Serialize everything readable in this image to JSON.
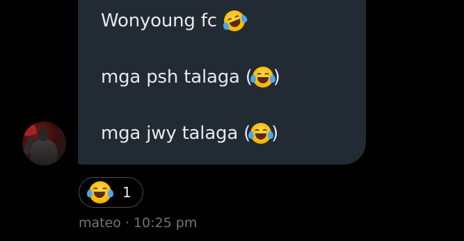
{
  "message": {
    "lines": [
      {
        "text": "Wonyoung fc",
        "emoji": "rolling-on-floor-laughing-emoji"
      },
      {
        "text": "mga psh talaga (",
        "emoji": "tears-of-joy-emoji",
        "after": ")"
      },
      {
        "text": "mga jwy talaga (",
        "emoji": "tears-of-joy-emoji",
        "after": ")"
      }
    ]
  },
  "reaction": {
    "emoji": "tears-of-joy-emoji",
    "count": "1"
  },
  "meta": {
    "sender": "mateo",
    "separator": "·",
    "time": "10:25 pm"
  },
  "colors": {
    "background": "#000000",
    "bubble": "#222b33",
    "text": "#e7e9ea",
    "muted": "#71767b",
    "reaction_border": "#4a5057"
  }
}
